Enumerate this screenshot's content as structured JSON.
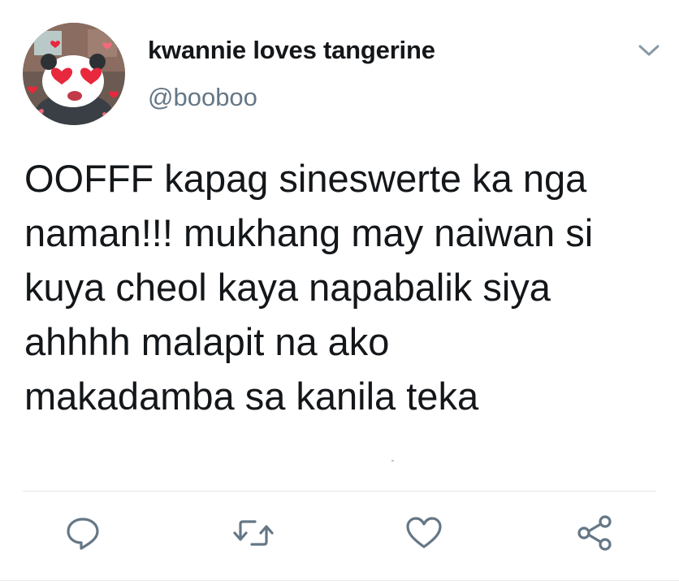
{
  "user": {
    "display_name": "kwannie loves tangerine",
    "handle": "@booboo"
  },
  "tweet": {
    "text": "OOFFF kapag sineswerte ka nga\nnaman!!! mukhang may naiwan si\nkuya cheol kaya napabalik siya\nahhhh malapit na ako\nmakadamba sa kanila teka"
  },
  "actions": [
    {
      "icon": "reply-icon"
    },
    {
      "icon": "retweet-icon"
    },
    {
      "icon": "like-icon"
    },
    {
      "icon": "share-icon"
    }
  ],
  "colors": {
    "text": "#14171a",
    "secondary": "#657786",
    "icon": "#657786",
    "divider": "#e1e8ed"
  }
}
